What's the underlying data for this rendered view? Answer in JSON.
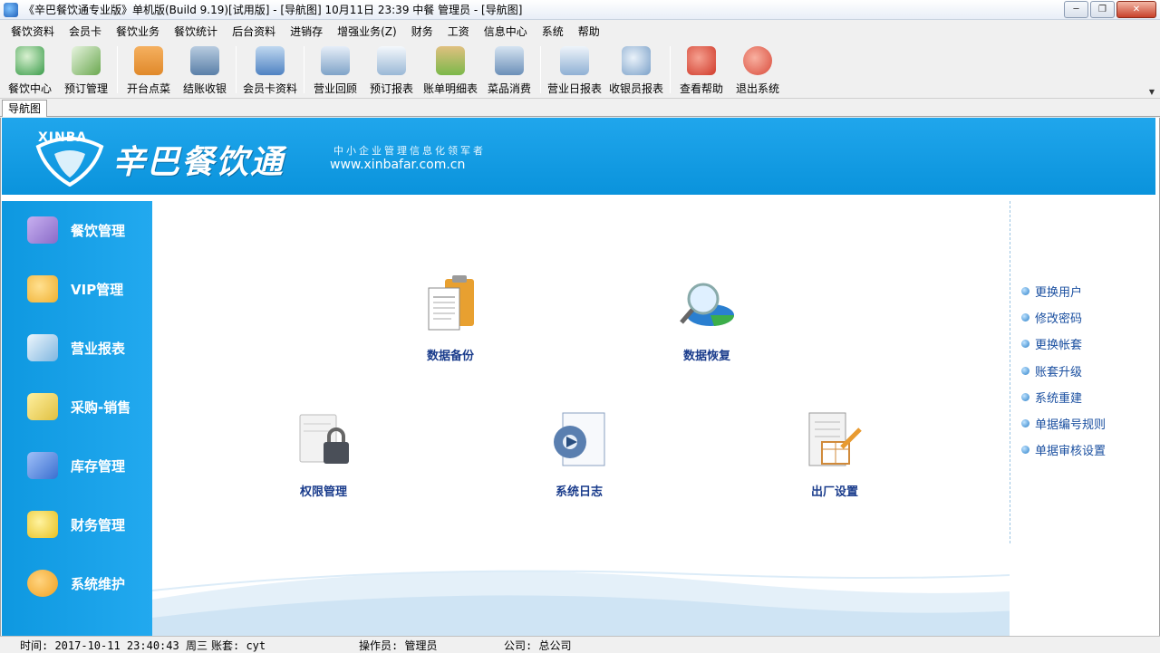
{
  "window": {
    "title": "《辛巴餐饮通专业版》单机版(Build 9.19)[试用版] - [导航图]  10月11日 23:39 中餐 管理员 - [导航图]",
    "minimize": "─",
    "restore": "❐",
    "close": "✕"
  },
  "menu": [
    "餐饮资料",
    "会员卡",
    "餐饮业务",
    "餐饮统计",
    "后台资料",
    "进销存",
    "增强业务(Z)",
    "财务",
    "工资",
    "信息中心",
    "系统",
    "帮助"
  ],
  "toolbar": [
    {
      "label": "餐饮中心",
      "icon": "globe-icon",
      "color": "#3a9c4a"
    },
    {
      "label": "预订管理",
      "icon": "booking-icon",
      "color": "#6aa84f"
    },
    {
      "label": "开台点菜",
      "icon": "house-icon",
      "color": "#e0892a"
    },
    {
      "label": "结账收银",
      "icon": "cash-icon",
      "color": "#5a7fa8"
    },
    {
      "label": "会员卡资料",
      "icon": "member-card-icon",
      "color": "#4f82c2"
    },
    {
      "label": "营业回顾",
      "icon": "review-icon",
      "color": "#7fa3c8"
    },
    {
      "label": "预订报表",
      "icon": "report-icon",
      "color": "#9ab8d6"
    },
    {
      "label": "账单明细表",
      "icon": "book-icon",
      "color": "#7bb84a"
    },
    {
      "label": "菜品消费",
      "icon": "dish-icon",
      "color": "#6b8fb8"
    },
    {
      "label": "营业日报表",
      "icon": "daily-report-icon",
      "color": "#8fb0d4"
    },
    {
      "label": "收银员报表",
      "icon": "cashier-report-icon",
      "color": "#7aa0c8"
    },
    {
      "label": "查看帮助",
      "icon": "help-icon",
      "color": "#d03a2a"
    },
    {
      "label": "退出系统",
      "icon": "power-icon",
      "color": "#d94a3a"
    }
  ],
  "tab": "导航图",
  "banner": {
    "xinba": "XINBA",
    "brand": "辛巴餐饮通",
    "slogan": "中小企业管理信息化领军者",
    "site": "www.xinbafar.com.cn"
  },
  "leftnav": [
    {
      "label": "餐饮管理",
      "icon": "dining-icon",
      "color": "#8a6bc8"
    },
    {
      "label": "VIP管理",
      "icon": "vip-icon",
      "color": "#f0b030"
    },
    {
      "label": "营业报表",
      "icon": "business-report-icon",
      "color": "#7fb6e0"
    },
    {
      "label": "采购-销售",
      "icon": "truck-icon",
      "color": "#e0c040"
    },
    {
      "label": "库存管理",
      "icon": "inventory-icon",
      "color": "#3a6fd0"
    },
    {
      "label": "财务管理",
      "icon": "finance-icon",
      "color": "#e8c020"
    },
    {
      "label": "系统维护",
      "icon": "maintenance-icon",
      "color": "#f0a020"
    }
  ],
  "functions": [
    {
      "label": "数据备份",
      "icon": "backup-icon"
    },
    {
      "label": "数据恢复",
      "icon": "restore-icon"
    },
    {
      "label": "权限管理",
      "icon": "permission-icon"
    },
    {
      "label": "系统日志",
      "icon": "log-icon"
    },
    {
      "label": "出厂设置",
      "icon": "factory-settings-icon"
    }
  ],
  "rightlinks": [
    "更换用户",
    "修改密码",
    "更换帐套",
    "账套升级",
    "系统重建",
    "单据编号规则",
    "单据审核设置"
  ],
  "status": {
    "time": "时间: 2017-10-11 23:40:43 周三",
    "account": "账套: cyt",
    "operator": "操作员: 管理员",
    "company": "公司: 总公司"
  }
}
